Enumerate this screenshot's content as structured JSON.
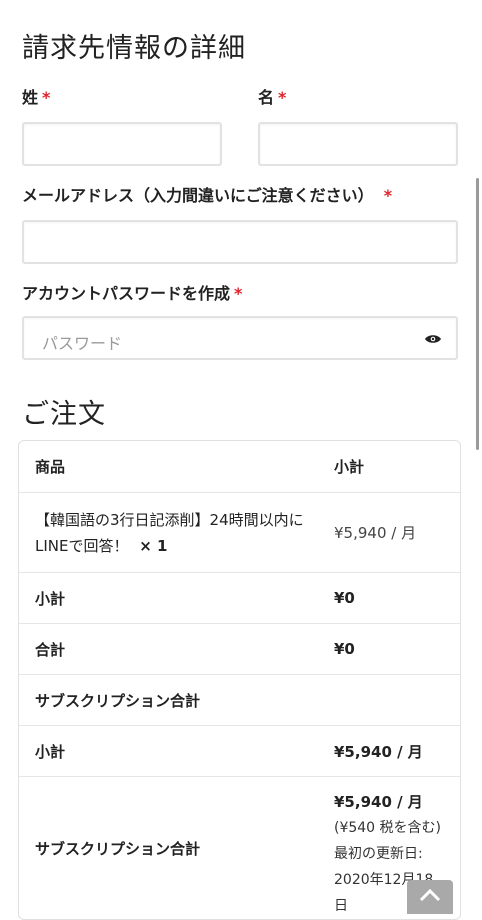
{
  "billing": {
    "title": "請求先情報の詳細",
    "last_name_label": "姓",
    "first_name_label": "名",
    "email_label": "メールアドレス（入力間違いにご注意ください）",
    "password_label": "アカウントパスワードを作成",
    "password_placeholder": "パスワード",
    "required_mark": "*"
  },
  "order": {
    "title": "ご注文",
    "header": {
      "product": "商品",
      "subtotal": "小計"
    },
    "item": {
      "name": "【韓国語の3行日記添削】24時間以内にLINEで回答！",
      "qty": "× 1",
      "price": "¥5,940 / 月"
    },
    "rows": [
      {
        "label": "小計",
        "value": "¥0"
      },
      {
        "label": "合計",
        "value": "¥0"
      },
      {
        "label": "サブスクリプション合計",
        "value": ""
      },
      {
        "label": "小計",
        "value": "¥5,940 / 月"
      }
    ],
    "recurring": {
      "label": "サブスクリプション合計",
      "amount": "¥5,940 / 月",
      "tax": "(¥540 税を含む)",
      "renewal_label": "最初の更新日:",
      "renewal_date": "2020年12月18日"
    }
  },
  "icons": {
    "password_toggle": "eye-icon",
    "back_to_top": "chevron-up-icon"
  }
}
